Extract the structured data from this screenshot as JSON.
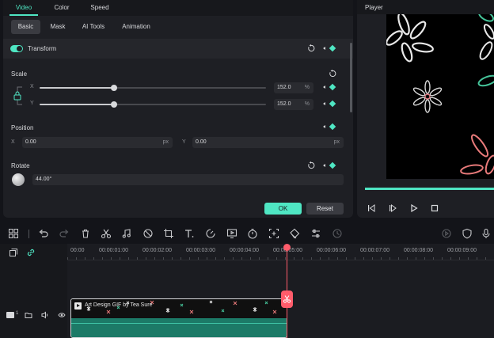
{
  "props": {
    "tabs": [
      "Video",
      "Color",
      "Speed"
    ],
    "subtabs": [
      "Basic",
      "Mask",
      "AI Tools",
      "Animation"
    ],
    "transform_label": "Transform",
    "scale": {
      "label": "Scale",
      "x_axis": "X",
      "y_axis": "Y",
      "x_value": "152.0",
      "y_value": "152.0",
      "unit": "%",
      "x_level": 0.33,
      "y_level": 0.33
    },
    "position": {
      "label": "Position",
      "x_axis": "X",
      "y_axis": "Y",
      "x_value": "0.00",
      "y_value": "0.00",
      "unit": "px"
    },
    "rotate": {
      "label": "Rotate",
      "value": "44.00°"
    },
    "ok_label": "OK",
    "reset_label": "Reset"
  },
  "player": {
    "title": "Player",
    "progress": 1.0
  },
  "toolbar": {
    "icons": [
      "grid-icon",
      "undo-icon",
      "redo-icon",
      "delete-icon",
      "cut-icon",
      "audio-icon",
      "mask-icon",
      "crop-icon",
      "text-icon",
      "speed-icon",
      "freeze-icon",
      "timer-icon",
      "crop-zoom-icon",
      "color-icon",
      "adjust-icon",
      "render-icon"
    ]
  },
  "timeline": {
    "ruler": [
      "00:00",
      "00:00:01:00",
      "00:00:02:00",
      "00:00:03:00",
      "00:00:04:00",
      "00:00:05:00",
      "00:00:06:00",
      "00:00:07:00",
      "00:00:08:00",
      "00:00:09:00"
    ],
    "track_number": "1",
    "clip_title": "Art Design GIF by Tea Sure"
  },
  "colors": {
    "accent": "#4fe6c3",
    "playhead": "#ff5c6b",
    "panel": "#1e1f24",
    "background": "#131419"
  }
}
